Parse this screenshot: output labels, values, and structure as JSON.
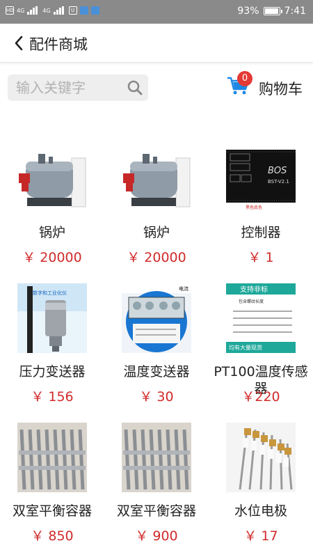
{
  "status_bar": {
    "left_icons": [
      "HD",
      "4G",
      "4G",
      "U"
    ],
    "battery": "93%",
    "battery_level": 0.93,
    "time": "7:41"
  },
  "header": {
    "title": "配件商城",
    "back_icon": "chevron-left-icon"
  },
  "search": {
    "placeholder": "输入关键字",
    "value": ""
  },
  "cart": {
    "label": "购物车",
    "count": "0"
  },
  "colors": {
    "price": "#d12a2a",
    "badge": "#e53935",
    "cart_icon": "#1e88e5",
    "status_bar": "#8a8a8a"
  },
  "products": [
    {
      "name": "锅炉",
      "price": "￥ 20000",
      "image": "boiler"
    },
    {
      "name": "锅炉",
      "price": "￥ 20000",
      "image": "boiler"
    },
    {
      "name": "控制器",
      "price": "￥ 1",
      "image": "controller"
    },
    {
      "name": "压力变送器",
      "price": "￥ 156",
      "image": "pressure-transmitter"
    },
    {
      "name": "温度变送器",
      "price": "￥ 30",
      "image": "temperature-transmitter"
    },
    {
      "name": "PT100温度传感器",
      "price": "￥220",
      "image": "pt100-sensor"
    },
    {
      "name": "双室平衡容器",
      "price": "￥ 850",
      "image": "balance-vessel"
    },
    {
      "name": "双室平衡容器",
      "price": "￥ 900",
      "image": "balance-vessel"
    },
    {
      "name": "水位电极",
      "price": "￥ 17",
      "image": "water-level-electrode"
    }
  ],
  "image_text": {
    "controller_brand": "BOS",
    "controller_model": "BST-V2.1",
    "controller_caption": "黑色底色",
    "pressure_caption": "数字和工业化仪",
    "temp_caption": "电流",
    "pt100_banner": "支持非标",
    "pt100_sub": "包含螺纹长度",
    "pt100_footer": "均有大量现货"
  }
}
